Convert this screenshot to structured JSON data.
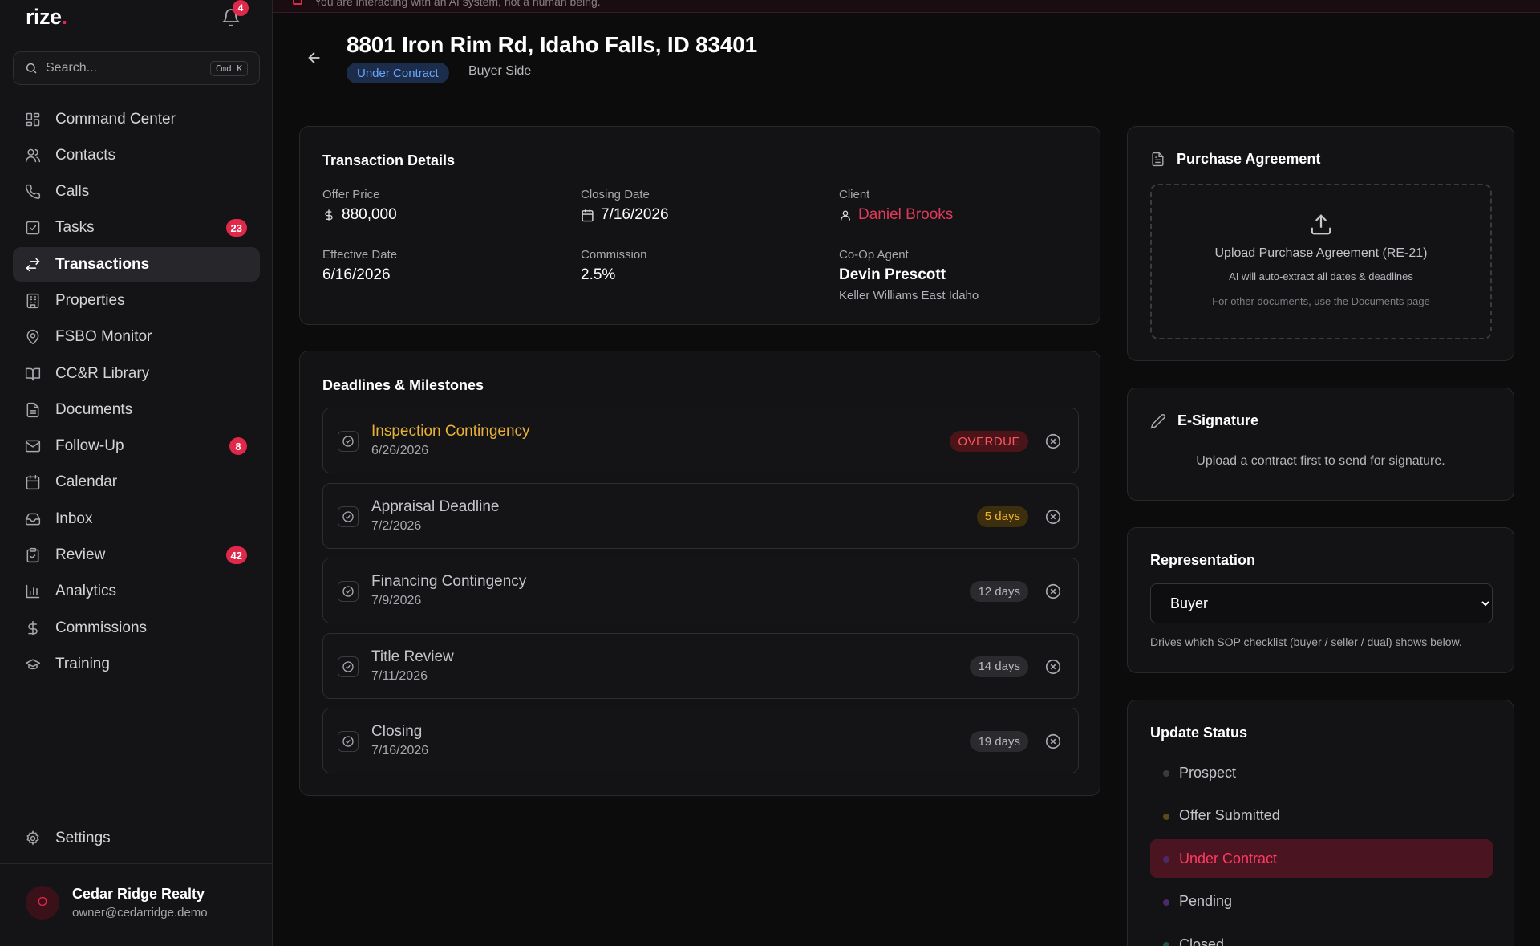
{
  "app": {
    "logo": "rize",
    "notifications_count": "4"
  },
  "banner": {
    "text": "You are interacting with an AI system, not a human being."
  },
  "search": {
    "placeholder": "Search...",
    "shortcut": "Cmd K"
  },
  "nav": [
    {
      "label": "Command Center",
      "icon": "grid-icon"
    },
    {
      "label": "Contacts",
      "icon": "users-icon"
    },
    {
      "label": "Calls",
      "icon": "phone-icon"
    },
    {
      "label": "Tasks",
      "icon": "checkbox-icon",
      "count": "23"
    },
    {
      "label": "Transactions",
      "icon": "arrows-icon",
      "active": true
    },
    {
      "label": "Properties",
      "icon": "building-icon"
    },
    {
      "label": "FSBO Monitor",
      "icon": "map-pin-icon"
    },
    {
      "label": "CC&R Library",
      "icon": "book-icon"
    },
    {
      "label": "Documents",
      "icon": "file-icon"
    },
    {
      "label": "Follow-Up",
      "icon": "mail-icon",
      "count": "8"
    },
    {
      "label": "Calendar",
      "icon": "calendar-icon"
    },
    {
      "label": "Inbox",
      "icon": "inbox-icon"
    },
    {
      "label": "Review",
      "icon": "clipboard-icon",
      "count": "42"
    },
    {
      "label": "Analytics",
      "icon": "bar-chart-icon"
    },
    {
      "label": "Commissions",
      "icon": "dollar-icon"
    },
    {
      "label": "Training",
      "icon": "graduation-cap-icon"
    }
  ],
  "settings_label": "Settings",
  "account": {
    "initial": "O",
    "name": "Cedar Ridge Realty",
    "email": "owner@cedarridge.demo"
  },
  "header": {
    "title": "8801 Iron Rim Rd, Idaho Falls, ID 83401",
    "status": "Under Contract",
    "side": "Buyer Side"
  },
  "transaction": {
    "title": "Transaction Details",
    "offer_price_label": "Offer Price",
    "offer_price": "880,000",
    "closing_date_label": "Closing Date",
    "closing_date": "7/16/2026",
    "client_label": "Client",
    "client": "Daniel Brooks",
    "effective_date_label": "Effective Date",
    "effective_date": "6/16/2026",
    "commission_label": "Commission",
    "commission": "2.5%",
    "coop_label": "Co-Op Agent",
    "coop_agent": "Devin Prescott",
    "coop_brokerage": "Keller Williams East Idaho"
  },
  "deadlines": {
    "title": "Deadlines & Milestones",
    "items": [
      {
        "name": "Inspection Contingency",
        "date": "6/26/2026",
        "tag": "OVERDUE",
        "kind": "overdue"
      },
      {
        "name": "Appraisal Deadline",
        "date": "7/2/2026",
        "tag": "5 days",
        "kind": "soon"
      },
      {
        "name": "Financing Contingency",
        "date": "7/9/2026",
        "tag": "12 days",
        "kind": "days"
      },
      {
        "name": "Title Review",
        "date": "7/11/2026",
        "tag": "14 days",
        "kind": "days"
      },
      {
        "name": "Closing",
        "date": "7/16/2026",
        "tag": "19 days",
        "kind": "days"
      }
    ]
  },
  "purchase_agreement": {
    "title": "Purchase Agreement",
    "upload_label": "Upload Purchase Agreement (RE-21)",
    "ai_note": "AI will auto-extract all dates & deadlines",
    "other_note": "For other documents, use the Documents page"
  },
  "esignature": {
    "title": "E-Signature",
    "text": "Upload a contract first to send for signature."
  },
  "representation": {
    "title": "Representation",
    "selected": "Buyer",
    "help": "Drives which SOP checklist (buyer / seller / dual) shows below."
  },
  "update_status": {
    "title": "Update Status",
    "items": [
      {
        "label": "Prospect",
        "color": "#3a3a40"
      },
      {
        "label": "Offer Submitted",
        "color": "#5a4a1a"
      },
      {
        "label": "Under Contract",
        "color": "#4a2a6a",
        "active": true
      },
      {
        "label": "Pending",
        "color": "#4a2a6a"
      },
      {
        "label": "Closed",
        "color": "#1a5a3a"
      }
    ]
  },
  "colors": {
    "accent": "#e0284a",
    "info": "#6aa4ff",
    "warning": "#e9b236"
  }
}
